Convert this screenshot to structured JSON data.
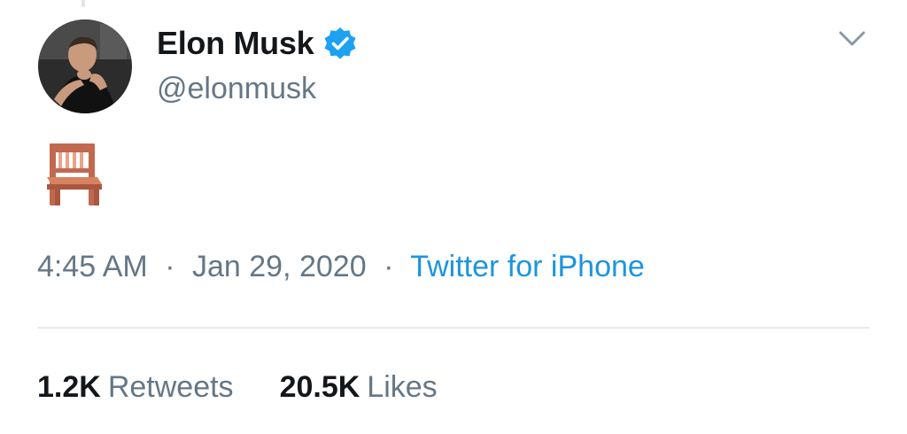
{
  "tweet": {
    "author": {
      "display_name": "Elon Musk",
      "handle": "@elonmusk",
      "verified": true,
      "avatar_icon": "profile-photo"
    },
    "content": {
      "emoji": "🪑",
      "emoji_name": "chair-emoji"
    },
    "meta": {
      "time": "4:45 AM",
      "separator": "·",
      "date": "Jan 29, 2020",
      "source": "Twitter for iPhone"
    },
    "stats": {
      "retweets_count": "1.2K",
      "retweets_label": "Retweets",
      "likes_count": "20.5K",
      "likes_label": "Likes"
    },
    "menu_icon": "chevron-down-icon"
  },
  "colors": {
    "text_primary": "#14171a",
    "text_secondary": "#657786",
    "link": "#1b95e0",
    "verified": "#1da1f2",
    "divider": "#e6ecf0"
  }
}
